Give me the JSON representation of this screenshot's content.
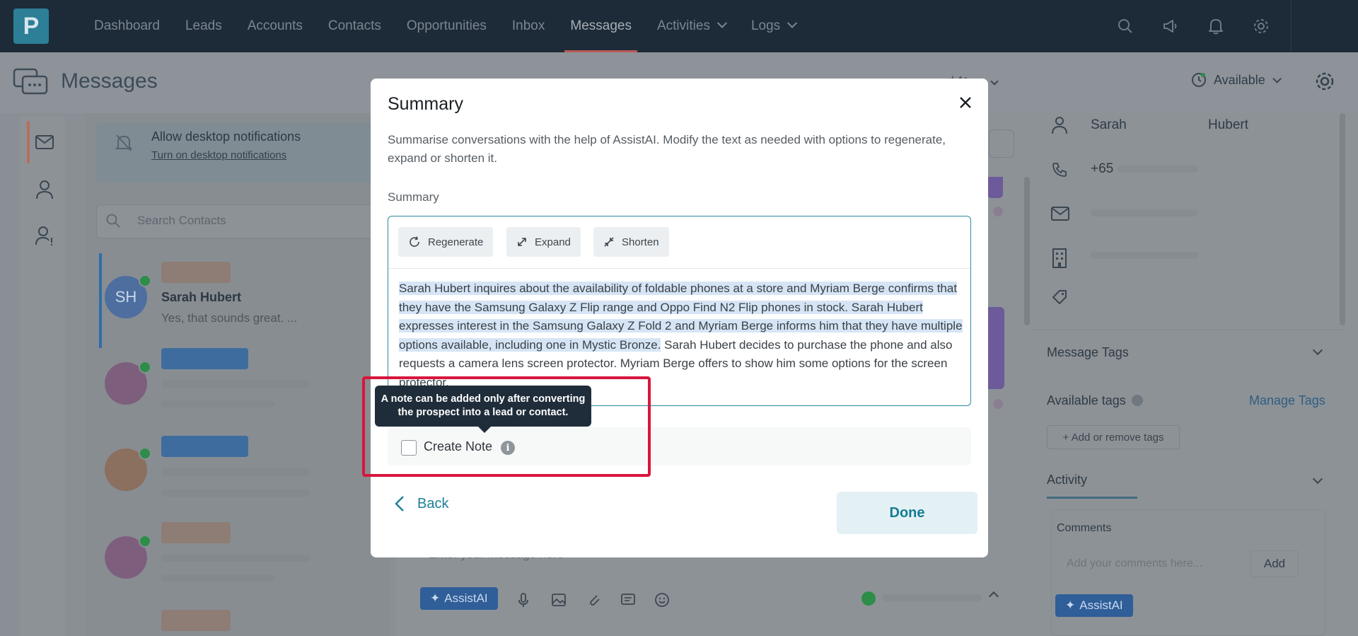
{
  "nav": {
    "logo": "P",
    "items": [
      {
        "label": "Dashboard"
      },
      {
        "label": "Leads"
      },
      {
        "label": "Accounts"
      },
      {
        "label": "Contacts"
      },
      {
        "label": "Opportunities"
      },
      {
        "label": "Inbox"
      },
      {
        "label": "Messages"
      },
      {
        "label": "Activities"
      },
      {
        "label": "Logs"
      }
    ],
    "active": "Messages"
  },
  "page": {
    "title": "Messages",
    "status": "Available",
    "filter_stub": "d At"
  },
  "notifications": {
    "title": "Allow desktop notifications",
    "link": "Turn on desktop notifications"
  },
  "search": {
    "placeholder": "Search Contacts"
  },
  "contacts": [
    {
      "initials": "SH",
      "name": "Sarah Hubert",
      "preview": "Yes, that sounds great. ..."
    }
  ],
  "right_panel": {
    "first_name": "Sarah",
    "last_name": "Hubert",
    "phone": "+65",
    "message_tags_heading": "Message Tags",
    "available_tags_label": "Available tags",
    "manage_tags_link": "Manage Tags",
    "add_tags_button": "+ Add or remove tags",
    "activity_heading": "Activity",
    "comments_label": "Comments",
    "comments_placeholder": "Add your comments here...",
    "add_button": "Add",
    "assist_button": "AssistAI"
  },
  "composer": {
    "placeholder": "Enter your message here",
    "assist_button": "AssistAI"
  },
  "modal": {
    "title": "Summary",
    "description": "Summarise conversations with the help of AssistAI. Modify the text as needed with options to regenerate, expand or shorten it.",
    "field_label": "Summary",
    "buttons": {
      "regenerate": "Regenerate",
      "expand": "Expand",
      "shorten": "Shorten"
    },
    "summary_highlighted": "Sarah Hubert inquires about the availability of foldable phones at a store and Myriam Berge confirms that they have the Samsung Galaxy Z Flip range and Oppo Find N2 Flip phones in stock. Sarah Hubert expresses interest in the Samsung Galaxy Z Fold 2 and Myriam Berge informs him that they have multiple options available, including one in Mystic Bronze.",
    "summary_rest": " Sarah Hubert decides to purchase the phone and also requests a camera lens screen protector. Myriam Berge offers to show him some options for the screen protector.",
    "tooltip": "A note can be added only after converting the prospect into a lead or contact.",
    "create_note_label": "Create Note",
    "back_label": "Back",
    "done_label": "Done"
  },
  "colors": {
    "accent": "#1c7f98",
    "nav_bg": "#1d2b38",
    "highlight_frame": "#d8163d",
    "selection": "#d6e5f5"
  }
}
